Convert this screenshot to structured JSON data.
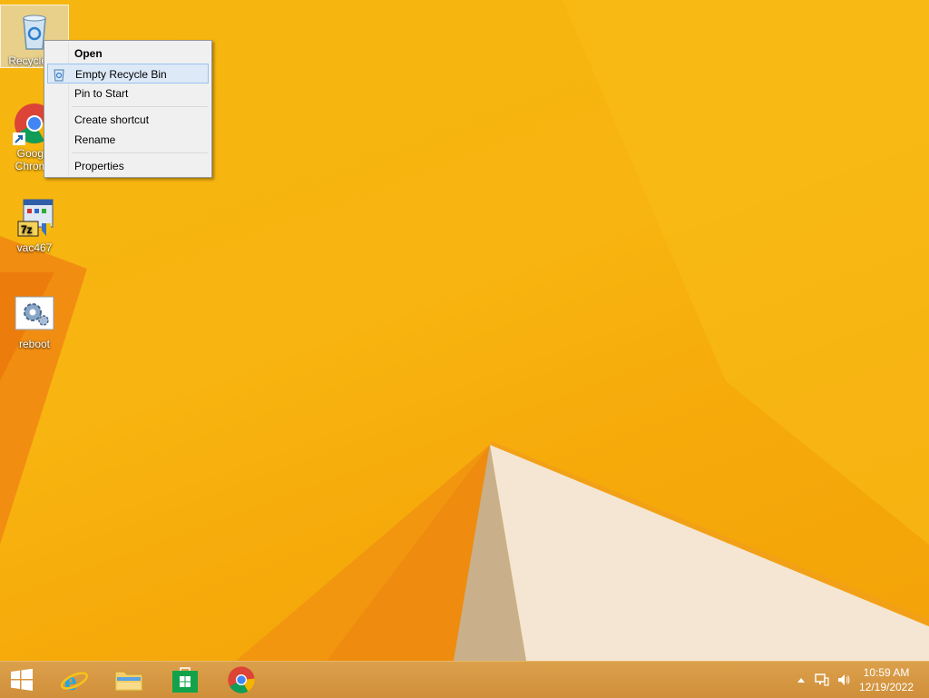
{
  "desktop": {
    "icons": [
      {
        "label": "Recycle Bin",
        "icon": "recycle-bin-icon"
      },
      {
        "label": "Google Chrome",
        "icon": "chrome-icon"
      },
      {
        "label": "vac467",
        "icon": "7zip-installer-icon"
      },
      {
        "label": "reboot",
        "icon": "reboot-gear-icon"
      }
    ]
  },
  "context_menu": {
    "items": [
      {
        "label": "Open",
        "bold": true
      },
      {
        "label": "Empty Recycle Bin",
        "hover": true,
        "icon": "recycle-bin-small-icon"
      },
      {
        "label": "Pin to Start"
      },
      {
        "label": "Create shortcut"
      },
      {
        "label": "Rename"
      },
      {
        "label": "Properties"
      }
    ]
  },
  "taskbar": {
    "apps": [
      {
        "name": "start-button",
        "icon": "windows-logo-icon"
      },
      {
        "name": "internet-explorer",
        "icon": "ie-icon"
      },
      {
        "name": "file-explorer",
        "icon": "folder-icon"
      },
      {
        "name": "store",
        "icon": "store-icon"
      },
      {
        "name": "chrome",
        "icon": "chrome-icon"
      }
    ],
    "tray": {
      "time": "10:59 AM",
      "date": "12/19/2022",
      "icons": [
        "show-hidden-icons-arrow",
        "network-icon",
        "volume-icon"
      ]
    }
  },
  "colors": {
    "wallpaper": "#f6b60f",
    "taskbar": "#d69a44",
    "menu_hover": "#dde9f7"
  }
}
